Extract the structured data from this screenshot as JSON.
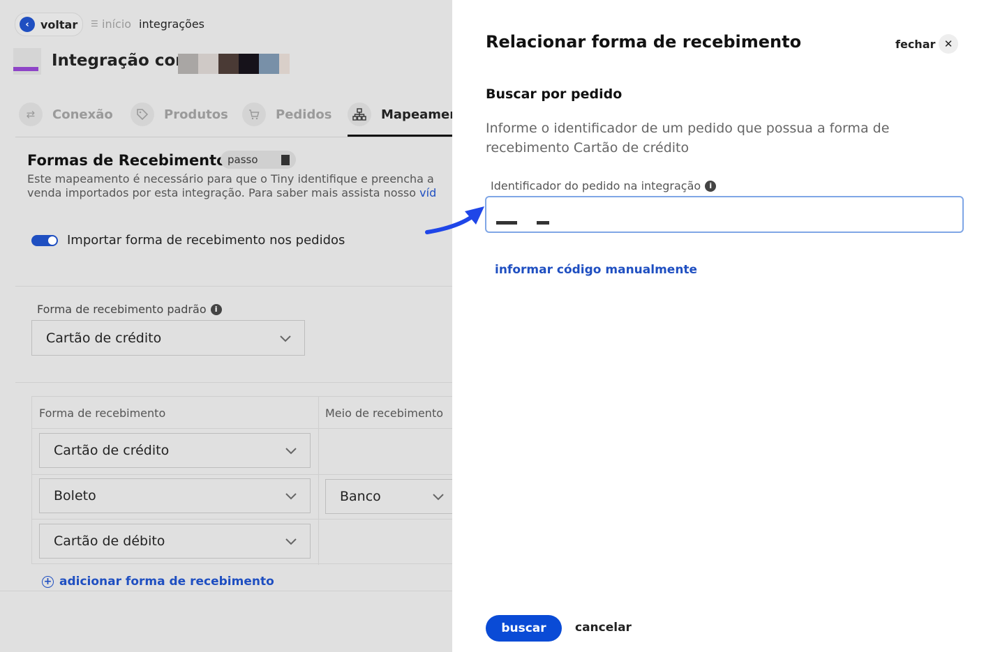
{
  "topbar": {
    "back_label": "voltar",
    "breadcrumbs": [
      "início",
      "integrações"
    ]
  },
  "header": {
    "title": "Integração com"
  },
  "tabs": [
    {
      "label": "Conexão",
      "icon": "arrows-exchange-icon"
    },
    {
      "label": "Produtos",
      "icon": "tag-icon"
    },
    {
      "label": "Pedidos",
      "icon": "cart-icon"
    },
    {
      "label": "Mapeamen",
      "icon": "sitemap-icon",
      "active": true
    }
  ],
  "section": {
    "title": "Formas de Recebimento",
    "badge": "passo",
    "description_line1": "Este mapeamento é necessário para que o Tiny identifique e preencha a",
    "description_line2": "venda importados por esta integração. Para saber mais assista nosso",
    "description_link": "víd"
  },
  "toggle": {
    "label": "Importar forma de recebimento nos pedidos",
    "on": true
  },
  "default_payment": {
    "label": "Forma de recebimento padrão",
    "value": "Cartão de crédito"
  },
  "table": {
    "headers": [
      "Forma de recebimento",
      "Meio de recebimento"
    ],
    "rows": [
      {
        "forma": "Cartão de crédito",
        "meio": ""
      },
      {
        "forma": "Boleto",
        "meio": "Banco"
      },
      {
        "forma": "Cartão de débito",
        "meio": ""
      }
    ]
  },
  "add_link": "adicionar forma de recebimento",
  "modal": {
    "title": "Relacionar forma de recebimento",
    "close_label": "fechar",
    "subtitle": "Buscar por pedido",
    "description": "Informe o identificador de um pedido que possua a forma de recebimento Cartão de crédito",
    "input_label": "Identificador do pedido na integração",
    "manual_link": "informar código manualmente",
    "primary_button": "buscar",
    "cancel_button": "cancelar"
  },
  "colors": {
    "accent": "#0a4bd6",
    "link": "#1f4fc1",
    "brand_bar": "#8e44c7",
    "overlay_bg": "#e0e0e0",
    "arrow": "#1f46e8"
  }
}
